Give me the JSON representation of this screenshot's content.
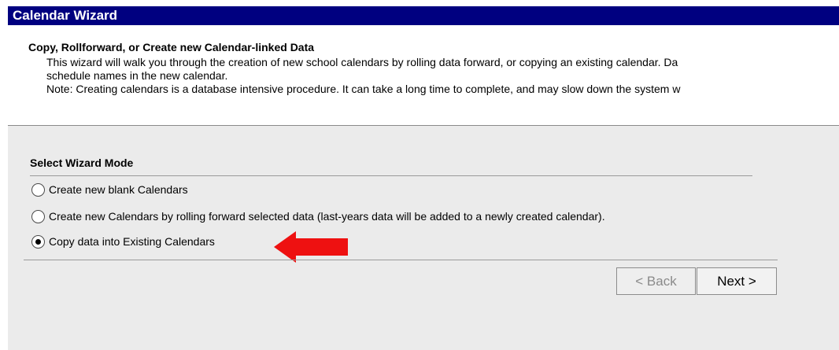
{
  "window": {
    "title": "Calendar Wizard"
  },
  "header": {
    "title": "Copy, Rollforward, or Create new Calendar-linked Data",
    "description_lines": [
      "This wizard will walk you through the creation of new school calendars by rolling data forward, or copying an existing calendar. Da",
      "schedule names in the new calendar.",
      "Note: Creating calendars is a database intensive procedure. It can take a long time to complete, and may slow down the system w"
    ]
  },
  "mode_section": {
    "title": "Select Wizard Mode",
    "options": [
      {
        "label": "Create new blank Calendars",
        "selected": false
      },
      {
        "label": "Create new Calendars by rolling forward selected data (last-years data will be added to a newly created calendar).",
        "selected": false
      },
      {
        "label": "Copy data into Existing Calendars",
        "selected": true
      }
    ]
  },
  "buttons": {
    "back": "< Back",
    "next": "Next >",
    "back_enabled": false
  },
  "annotation": {
    "icon": "red-arrow-icon",
    "color": "#ee1111"
  },
  "colors": {
    "titlebar_bg": "#000080",
    "panel_bg": "#ebebeb"
  }
}
